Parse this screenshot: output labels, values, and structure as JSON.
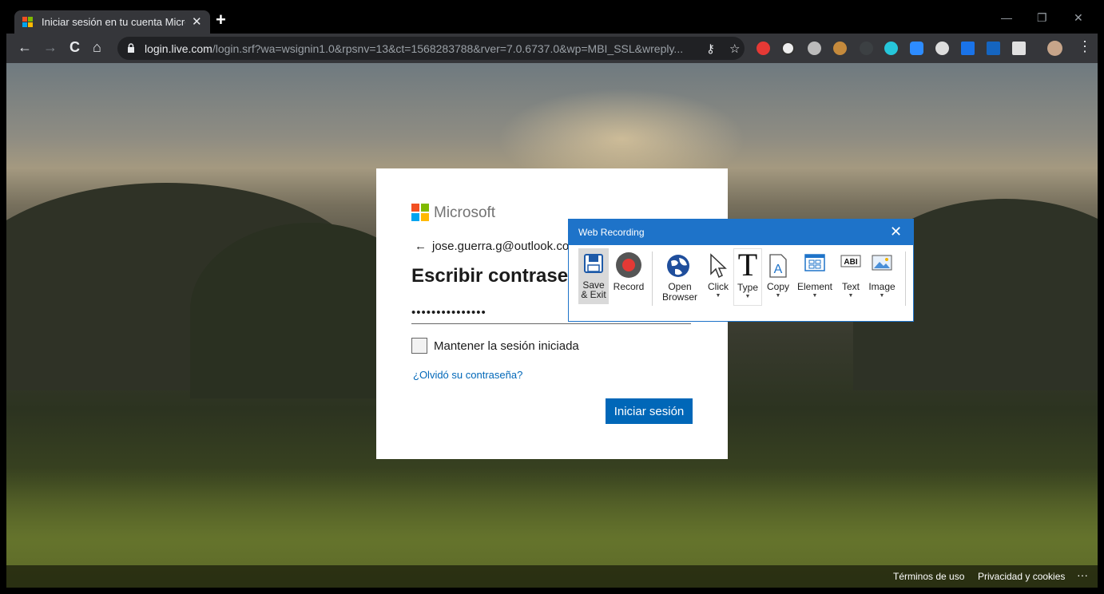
{
  "browser": {
    "tab_title": "Iniciar sesión en tu cuenta Micro",
    "tab_close": "✕",
    "new_tab": "+",
    "url_host": "login.live.com",
    "url_rest": "/login.srf?wa=wsignin1.0&rpsnv=13&ct=1568283788&rver=7.0.6737.0&wp=MBI_SSL&wreply...",
    "nav": {
      "back": "←",
      "forward": "→",
      "reload": "C",
      "home": "⌂"
    },
    "omni_key_icon": "⚷",
    "omni_star_icon": "☆",
    "menu_icon": "⋮",
    "window": {
      "minimize": "—",
      "restore": "❐",
      "close": "✕"
    }
  },
  "login": {
    "brand": "Microsoft",
    "back_arrow": "←",
    "identity": "jose.guerra.g@outlook.com",
    "heading": "Escribir contraseña",
    "password_value": "•••••••••••••••",
    "keep_signed_in": "Mantener la sesión iniciada",
    "forgot": "¿Olvidó su contraseña?",
    "signin_button": "Iniciar sesión"
  },
  "footer": {
    "terms": "Términos de uso",
    "privacy": "Privacidad y cookies",
    "more": "···"
  },
  "recorder": {
    "title": "Web Recording",
    "close": "✕",
    "buttons": {
      "save_exit_1": "Save",
      "save_exit_2": "& Exit",
      "record": "Record",
      "open_browser_1": "Open",
      "open_browser_2": "Browser",
      "click": "Click",
      "type": "Type",
      "copy": "Copy",
      "element": "Element",
      "text": "Text",
      "image": "Image"
    }
  },
  "colors": {
    "ms_blue": "#0067b8",
    "recorder_blue": "#1e73c9"
  }
}
